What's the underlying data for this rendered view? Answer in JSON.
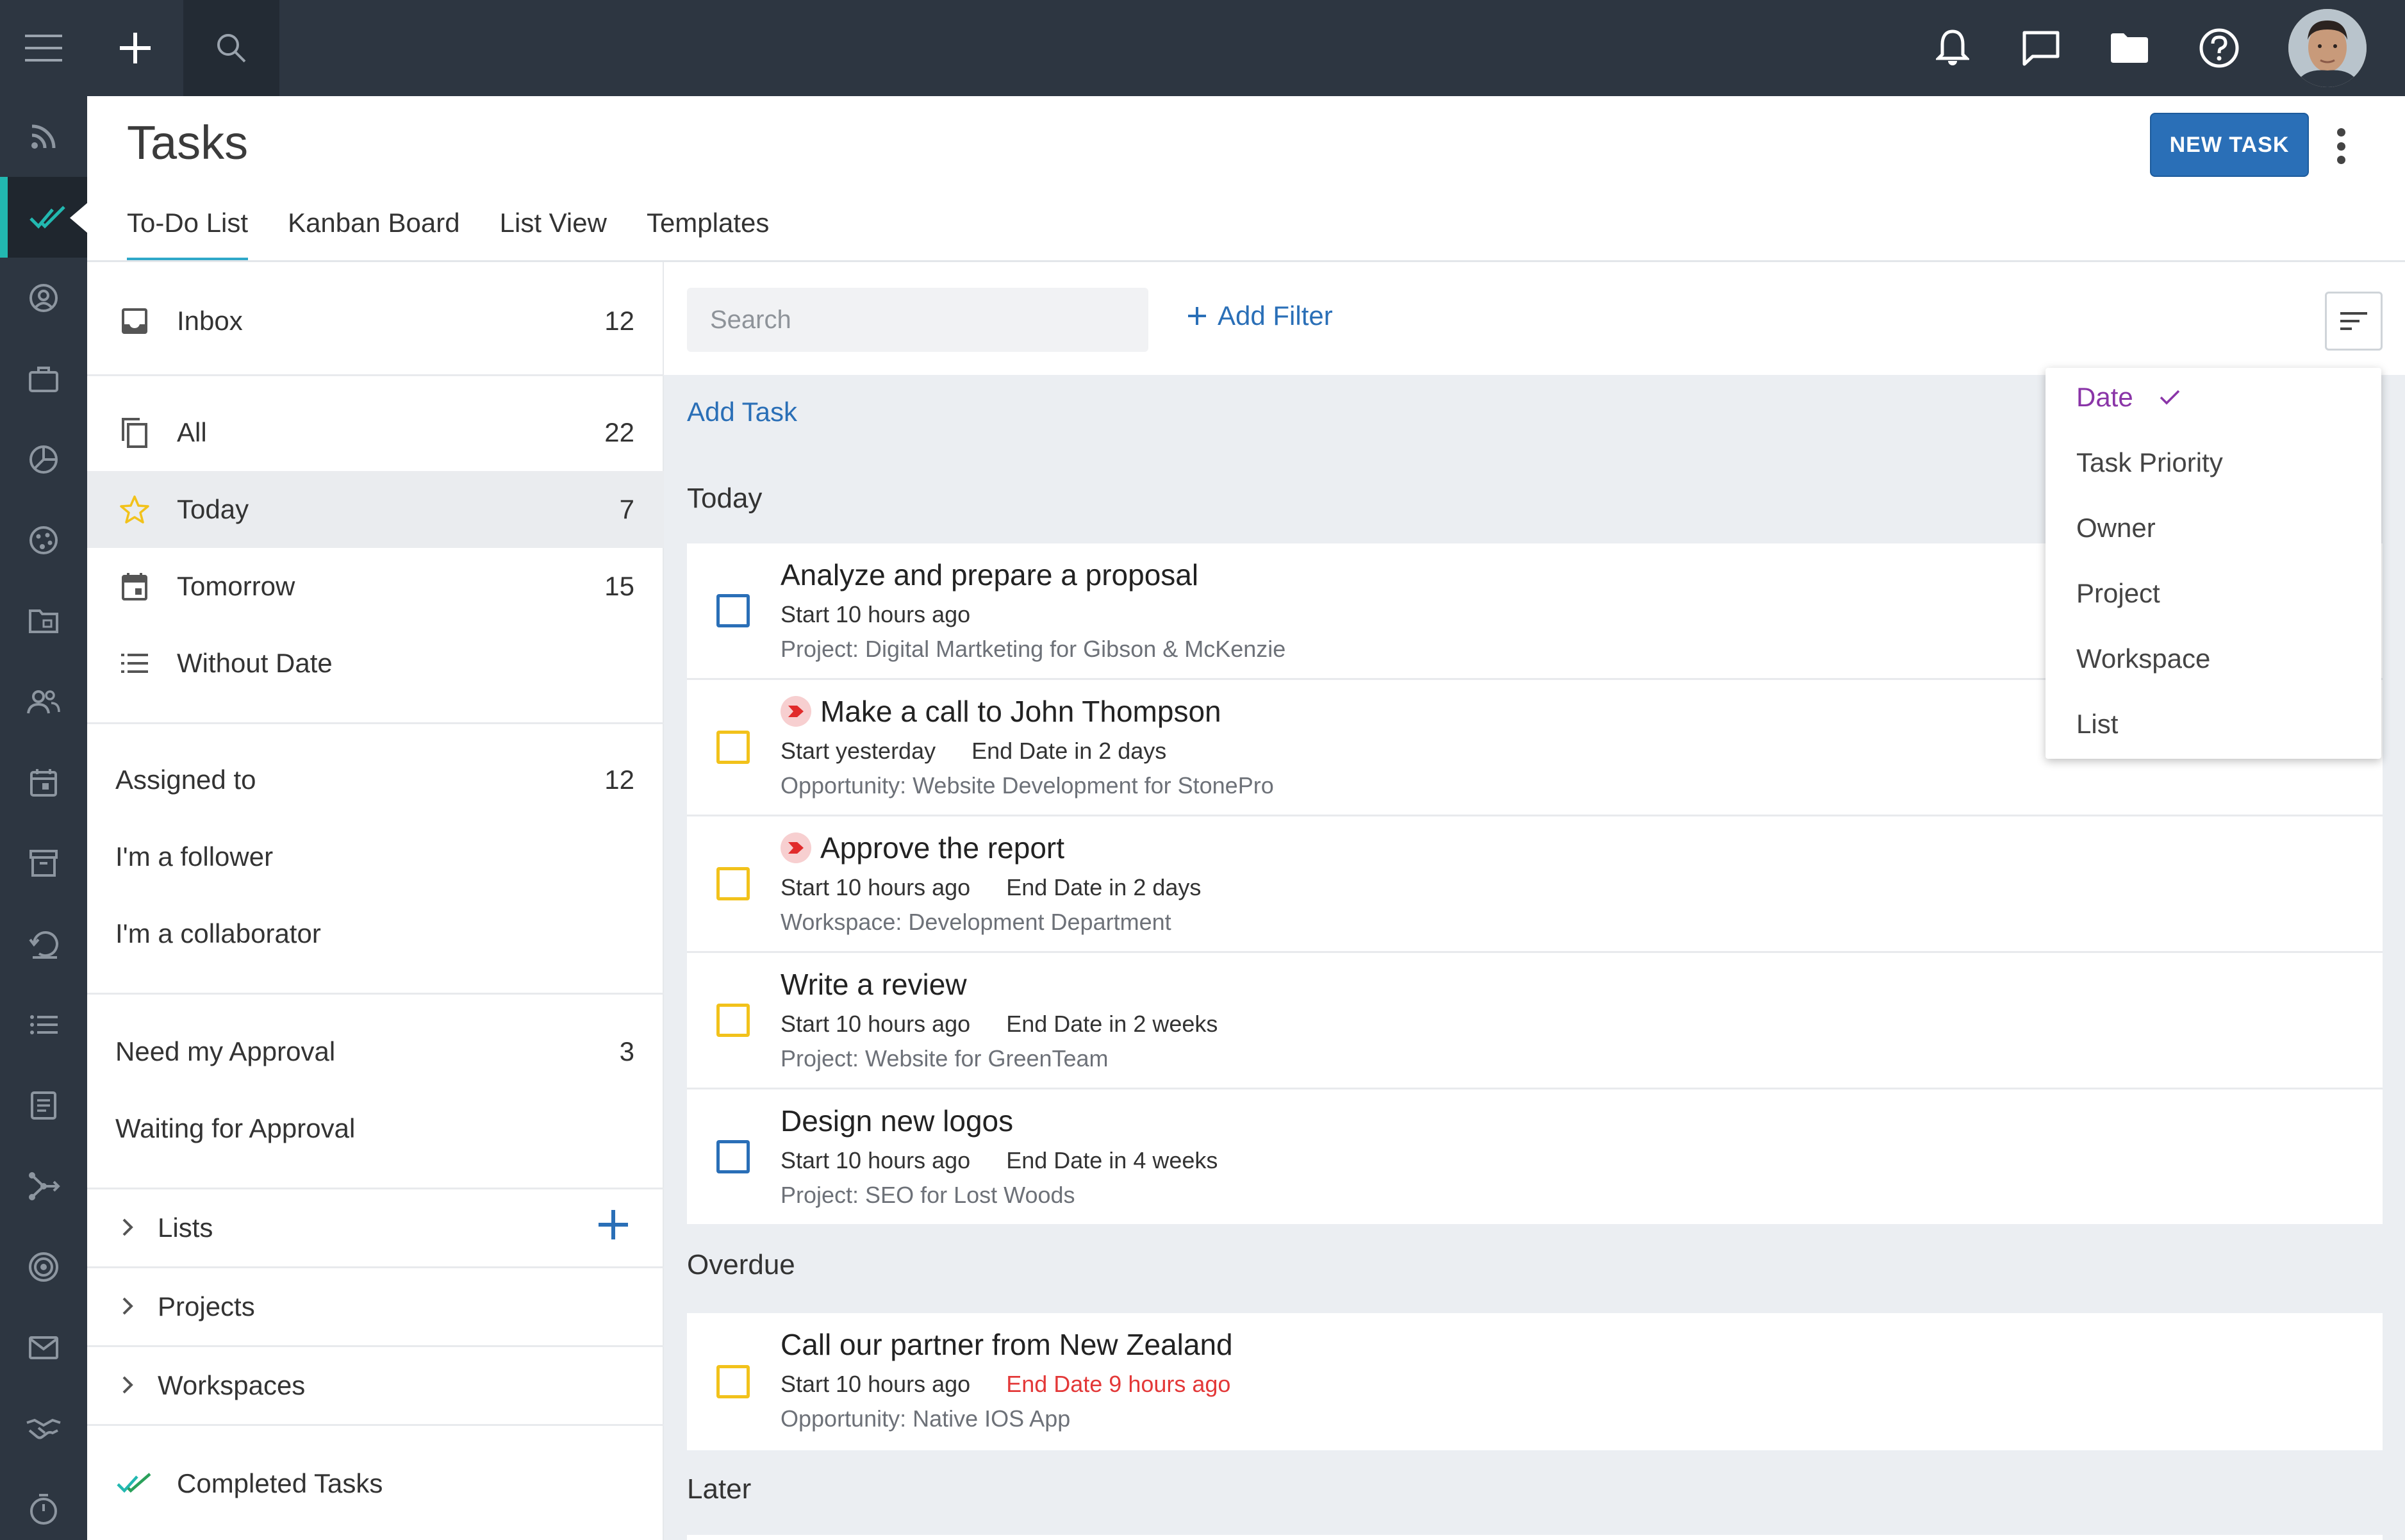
{
  "header": {
    "title": "Tasks",
    "new_task_label": "NEW TASK",
    "tabs": [
      "To-Do List",
      "Kanban Board",
      "List View",
      "Templates"
    ],
    "active_tab": "To-Do List"
  },
  "topbar": {
    "icons": [
      "menu-icon",
      "plus-icon",
      "search-icon",
      "bell-icon",
      "chat-icon",
      "folder-icon",
      "help-icon",
      "avatar"
    ]
  },
  "rail": {
    "icons": [
      "rss-icon",
      "tasks-icon",
      "contacts-icon",
      "briefcase-icon",
      "pie-chart-icon",
      "palette-icon",
      "folder-icon",
      "users-icon",
      "calendar-icon",
      "archive-icon",
      "history-icon",
      "list-icon",
      "document-icon",
      "workflow-icon",
      "target-icon",
      "mail-icon",
      "handshake-icon",
      "timer-icon"
    ],
    "active": "tasks-icon"
  },
  "sidebar": {
    "inbox": {
      "label": "Inbox",
      "count": "12"
    },
    "views": [
      {
        "label": "All",
        "count": "22",
        "icon": "copy-icon"
      },
      {
        "label": "Today",
        "count": "7",
        "icon": "star-icon"
      },
      {
        "label": "Tomorrow",
        "count": "15",
        "icon": "calendar-icon"
      },
      {
        "label": "Without Date",
        "count": "",
        "icon": "list-icon"
      }
    ],
    "assignment": [
      {
        "label": "Assigned to",
        "count": "12"
      },
      {
        "label": "I'm a follower",
        "count": ""
      },
      {
        "label": "I'm a collaborator",
        "count": ""
      }
    ],
    "approval": [
      {
        "label": "Need my Approval",
        "count": "3"
      },
      {
        "label": "Waiting for Approval",
        "count": ""
      }
    ],
    "groups": [
      "Lists",
      "Projects",
      "Workspaces"
    ],
    "completed": "Completed Tasks"
  },
  "toolbar": {
    "search_placeholder": "Search",
    "add_filter": "Add Filter"
  },
  "main": {
    "add_task": "Add Task",
    "sections": {
      "today": "Today",
      "overdue": "Overdue",
      "later": "Later"
    },
    "tasks": [
      {
        "title": "Analyze and prepare a proposal",
        "start": "Start 10 hours ago",
        "end": "",
        "context": "Project: Digital Martketing for Gibson & McKenzie",
        "checkbox_color": "#2a6fb7",
        "priority": false
      },
      {
        "title": "Make a call to John Thompson",
        "start": "Start yesterday",
        "end": "End Date in 2 days",
        "context": "Opportunity: Website Development for StonePro",
        "checkbox_color": "#f2c21b",
        "priority": true
      },
      {
        "title": "Approve the report",
        "start": "Start 10 hours ago",
        "end": "End Date in 2 days",
        "context": "Workspace: Development Department",
        "checkbox_color": "#f2c21b",
        "priority": true
      },
      {
        "title": "Write a review",
        "start": "Start 10 hours ago",
        "end": "End Date in 2 weeks",
        "context": "Project: Website for GreenTeam",
        "checkbox_color": "#f2c21b",
        "priority": false
      },
      {
        "title": "Design new logos",
        "start": "Start 10 hours ago",
        "end": "End Date in 4 weeks",
        "context": "Project: SEO for Lost Woods",
        "checkbox_color": "#2a6fb7",
        "priority": false
      }
    ],
    "overdue_tasks": [
      {
        "title": "Call our partner from New Zealand",
        "start": "Start 10 hours ago",
        "end": "End Date 9 hours ago",
        "context": "Opportunity: Native IOS App",
        "checkbox_color": "#f2c21b",
        "end_color": "#e33838"
      }
    ]
  },
  "sort_menu": {
    "items": [
      "Date",
      "Task Priority",
      "Owner",
      "Project",
      "Workspace",
      "List"
    ],
    "selected": "Date",
    "selected_color": "#8a35a8"
  },
  "colors": {
    "topbar": "#2d3641",
    "accent_blue": "#2a6fb7",
    "rail_active": "#22b8b0",
    "overdue_red": "#e33838"
  }
}
